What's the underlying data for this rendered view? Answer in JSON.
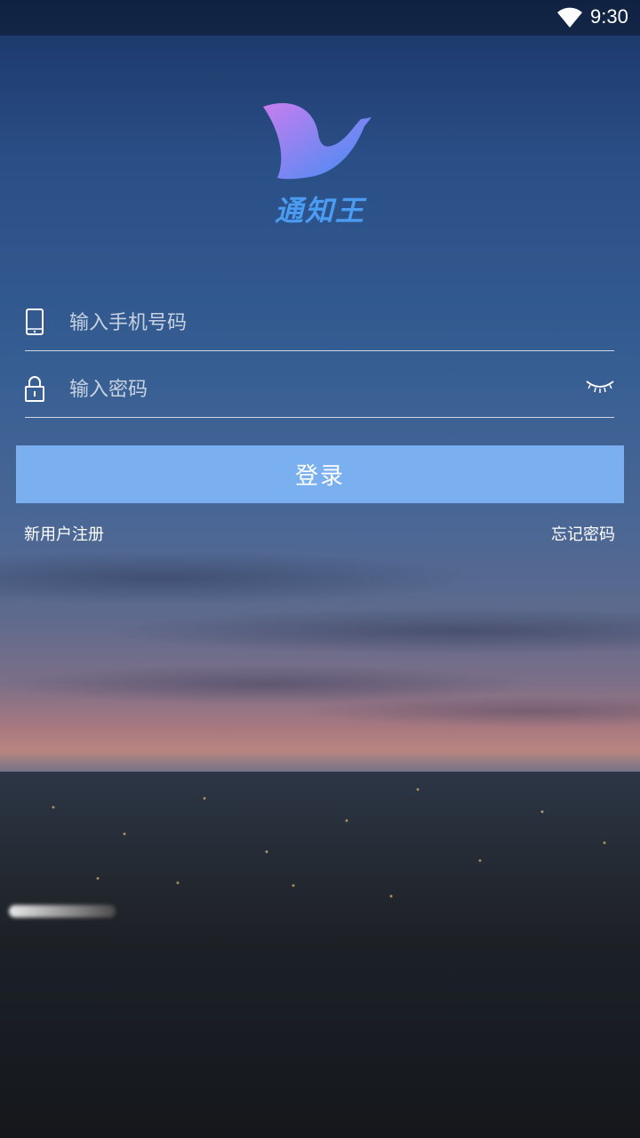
{
  "status_bar": {
    "time": "9:30",
    "wifi_icon": "wifi-icon"
  },
  "logo": {
    "icon": "bird-logo-icon",
    "app_name": "通知王",
    "gradient": [
      "#c77dee",
      "#3f8df5"
    ]
  },
  "form": {
    "phone": {
      "icon": "phone-icon",
      "placeholder": "输入手机号码",
      "value": ""
    },
    "password": {
      "icon": "lock-icon",
      "placeholder": "输入密码",
      "value": "",
      "toggle_icon": "eye-closed-icon"
    }
  },
  "login_button": {
    "label": "登录",
    "color": "#7ab0ef"
  },
  "links": {
    "register": "新用户注册",
    "forgot": "忘记密码"
  },
  "colors": {
    "brand": "#4a9cf2"
  }
}
